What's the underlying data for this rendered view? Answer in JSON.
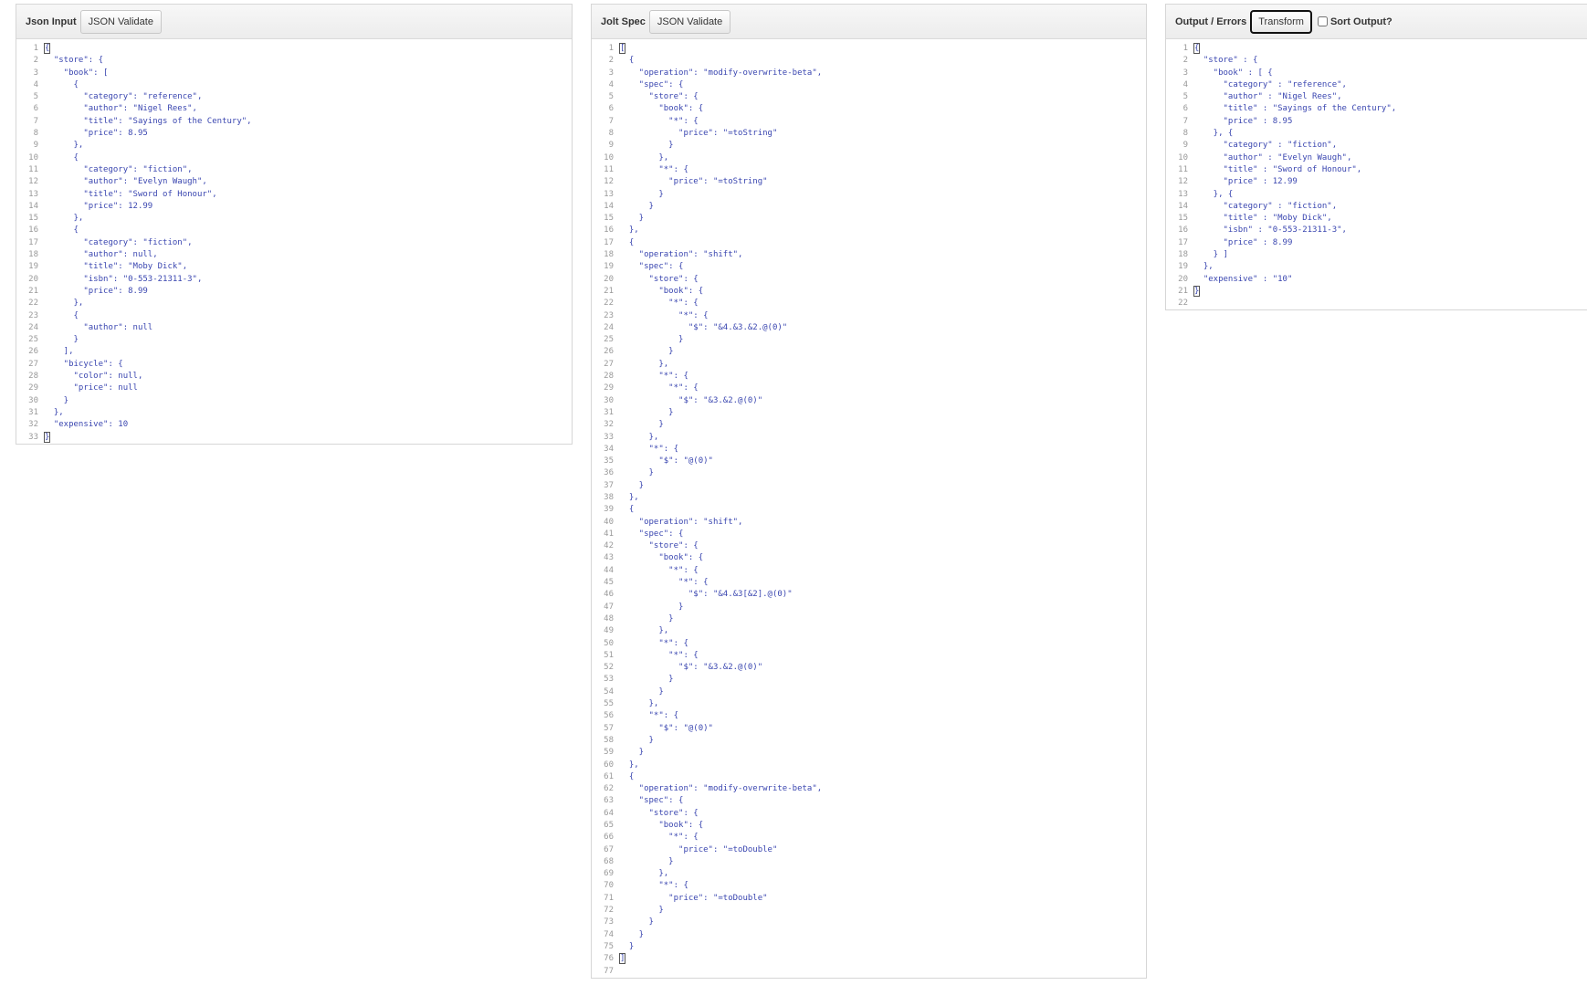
{
  "panels": {
    "input": {
      "title": "Json Input",
      "validate_label": "JSON Validate",
      "lines": [
        "{",
        "  \"store\": {",
        "    \"book\": [",
        "      {",
        "        \"category\": \"reference\",",
        "        \"author\": \"Nigel Rees\",",
        "        \"title\": \"Sayings of the Century\",",
        "        \"price\": 8.95",
        "      },",
        "      {",
        "        \"category\": \"fiction\",",
        "        \"author\": \"Evelyn Waugh\",",
        "        \"title\": \"Sword of Honour\",",
        "        \"price\": 12.99",
        "      },",
        "      {",
        "        \"category\": \"fiction\",",
        "        \"author\": null,",
        "        \"title\": \"Moby Dick\",",
        "        \"isbn\": \"0-553-21311-3\",",
        "        \"price\": 8.99",
        "      },",
        "      {",
        "        \"author\": null",
        "      }",
        "    ],",
        "    \"bicycle\": {",
        "      \"color\": null,",
        "      \"price\": null",
        "    }",
        "  },",
        "  \"expensive\": 10",
        "}"
      ]
    },
    "spec": {
      "title": "Jolt Spec",
      "validate_label": "JSON Validate",
      "lines": [
        "[",
        "  {",
        "    \"operation\": \"modify-overwrite-beta\",",
        "    \"spec\": {",
        "      \"store\": {",
        "        \"book\": {",
        "          \"*\": {",
        "            \"price\": \"=toString\"",
        "          }",
        "        },",
        "        \"*\": {",
        "          \"price\": \"=toString\"",
        "        }",
        "      }",
        "    }",
        "  },",
        "  {",
        "    \"operation\": \"shift\",",
        "    \"spec\": {",
        "      \"store\": {",
        "        \"book\": {",
        "          \"*\": {",
        "            \"*\": {",
        "              \"$\": \"&4.&3.&2.@(0)\"",
        "            }",
        "          }",
        "        },",
        "        \"*\": {",
        "          \"*\": {",
        "            \"$\": \"&3.&2.@(0)\"",
        "          }",
        "        }",
        "      },",
        "      \"*\": {",
        "        \"$\": \"@(0)\"",
        "      }",
        "    }",
        "  },",
        "  {",
        "    \"operation\": \"shift\",",
        "    \"spec\": {",
        "      \"store\": {",
        "        \"book\": {",
        "          \"*\": {",
        "            \"*\": {",
        "              \"$\": \"&4.&3[&2].@(0)\"",
        "            }",
        "          }",
        "        },",
        "        \"*\": {",
        "          \"*\": {",
        "            \"$\": \"&3.&2.@(0)\"",
        "          }",
        "        }",
        "      },",
        "      \"*\": {",
        "        \"$\": \"@(0)\"",
        "      }",
        "    }",
        "  },",
        "  {",
        "    \"operation\": \"modify-overwrite-beta\",",
        "    \"spec\": {",
        "      \"store\": {",
        "        \"book\": {",
        "          \"*\": {",
        "            \"price\": \"=toDouble\"",
        "          }",
        "        },",
        "        \"*\": {",
        "          \"price\": \"=toDouble\"",
        "        }",
        "      }",
        "    }",
        "  }",
        "]",
        ""
      ]
    },
    "output": {
      "title": "Output / Errors",
      "transform_label": "Transform",
      "sort_label": "Sort Output?",
      "sort_checked": false,
      "lines": [
        "{",
        "  \"store\" : {",
        "    \"book\" : [ {",
        "      \"category\" : \"reference\",",
        "      \"author\" : \"Nigel Rees\",",
        "      \"title\" : \"Sayings of the Century\",",
        "      \"price\" : 8.95",
        "    }, {",
        "      \"category\" : \"fiction\",",
        "      \"author\" : \"Evelyn Waugh\",",
        "      \"title\" : \"Sword of Honour\",",
        "      \"price\" : 12.99",
        "    }, {",
        "      \"category\" : \"fiction\",",
        "      \"title\" : \"Moby Dick\",",
        "      \"isbn\" : \"0-553-21311-3\",",
        "      \"price\" : 8.99",
        "    } ]",
        "  },",
        "  \"expensive\" : \"10\"",
        "}",
        ""
      ]
    }
  }
}
